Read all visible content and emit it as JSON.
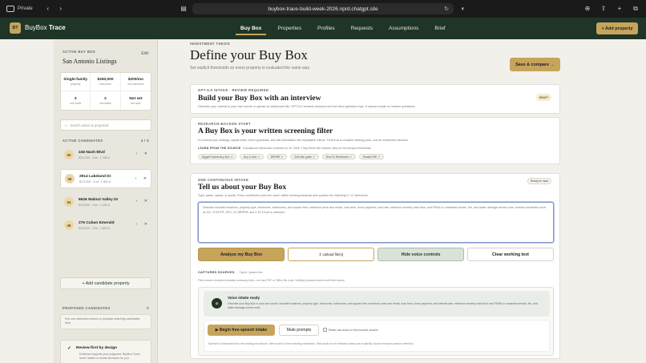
{
  "browser": {
    "private_label": "Private",
    "url": "buybox-trace-build-week-2026.nprd.chatgpt.site"
  },
  "app": {
    "logo": "BT",
    "brand_a": "BuyBox",
    "brand_b": "Trace",
    "nav": [
      "Buy Box",
      "Properties",
      "Profiles",
      "Requests",
      "Assumptions",
      "Brief"
    ],
    "add_property": "+ Add property"
  },
  "sidebar": {
    "active_label": "ACTIVE BUY BOX",
    "edit": "Edit",
    "title": "San Antonio Listings",
    "criteria": [
      {
        "value": "Single-family",
        "sub": "property"
      },
      {
        "value": "$260,000",
        "sub": "max price"
      },
      {
        "value": "$200/mo",
        "sub": "min cash flow"
      },
      {
        "value": "3",
        "sub": "min beds"
      },
      {
        "value": "2",
        "sub": "min baths"
      },
      {
        "value": "Not set",
        "sub": "min size"
      }
    ],
    "search_placeholder": "Search active & proposed",
    "candidates_label": "ACTIVE CANDIDATES",
    "candidates_count": "4 / 5",
    "candidates": [
      {
        "score": "56",
        "name": "246 Nash Blvd",
        "details": "$210,000 · 3 bd · 1,768 sf"
      },
      {
        "score": "58",
        "name": "2914 Lakeland Dr",
        "details": "$175,000 · 4 bd · 1,350 sf"
      },
      {
        "score": "54",
        "name": "6626 Walnut Valley Dr",
        "details": "$149,900 · 4 bd · 1,168 sf"
      },
      {
        "score": "48",
        "name": "276 Cuban Emerald",
        "details": "$229,000 · 3 bd · 1,653 sf"
      }
    ],
    "add_candidate": "+ Add candidate property",
    "proposed_label": "PROPOSED CANDIDATES",
    "proposed_count": "0",
    "proposed_text": "Run one authorized search to populate matching candidates here.",
    "review_title": "Review-first by design",
    "review_body": "Evidence supports your judgment. BuyBox Trace never makes or sends decisions for you."
  },
  "main": {
    "eyebrow": "INVESTMENT THESIS",
    "title": "Define your Buy Box",
    "subtitle": "Set explicit thresholds so every property is evaluated the same way.",
    "save_compare": "Save & compare →",
    "card1": {
      "eyebrow": "GPT-5.5 INTAKE · REVIEW REQUIRED",
      "title": "Build your Buy Box with an interview",
      "desc": "Describe your criteria in your own words or upload an authorized file. GPT-5.5 extracts answers into the fixed question map. It cannot create or rename questions.",
      "badge": "DRAFT"
    },
    "card2": {
      "eyebrow": "RESEARCH-BACKED START",
      "title": "A Buy Box is your written screening filter",
      "desc": "It connects your strategy, capital limits, return guardrails, and risk boundaries into repeatable criteria. Treat it as a reusable starting point—not an investment decision.",
      "learn_label": "LEARN FROM THE SOURCE",
      "learn_note": "Educational references reviewed on 10, 2026. They inform the choices; they do not set your thresholds.",
      "chips": [
        "BiggerPockets Buy Box ↗",
        "Buy & hold ↗",
        "BRRRR ↗",
        "SAN title guide ↗",
        "Rent To Retirement ↗",
        "RealtorCRE ↗"
      ]
    },
    "card3": {
      "eyebrow": "ONE CONTINUOUS INTAKE",
      "title": "Tell us about your Buy Box",
      "desc": "Type, paste, upload, or speak. Every contribution joins the same visible working transcript and updates the matching 0 / 47 selections.",
      "ready": "Ready for input",
      "textarea_placeholder": "Describe included locations, property type, bedrooms, bathrooms, and square feet; maximum price and rehab, loan term, down payment, and rate; minimum monthly cash flow; and FEMA or unwanted smoke, fire, and water damage screen-outs. Investor shorthand such as 3/2, LTV/DTR, SFH, JV, BRRRR, and 2-10-15 yrs is welcome.",
      "buttons": [
        "Analyze my Buy Box",
        "↥ Upload file(s)",
        "Hide voice controls",
        "Clear working text"
      ],
      "captured_label": "CAPTURED SOURCES",
      "captured_typed": "Typed / pasted text",
      "captured_desc": "Files create a tracked extracted summary here—not raw PDF or Office file code. Nothing becomes active until final review.",
      "voice_title": "Voice intake ready",
      "voice_desc": "Describe your Buy Box in your own words: included locations, property type, bedrooms, bathrooms, and square feet; maximum price and rehab, loan term, down payment, and interest rate; minimum monthly cash flow; and FEMA or unwanted smoke, fire, and water damage screen-outs.",
      "begin": "▶ Begin free-speech intake",
      "mute": "Mute prompts",
      "retain": "Retain raw audio for this browser session",
      "note": "Speech is transcribed into the working text above, then routed to the matching selections. Raw audio is not retained unless you explicitly choose browser-session retention."
    }
  }
}
